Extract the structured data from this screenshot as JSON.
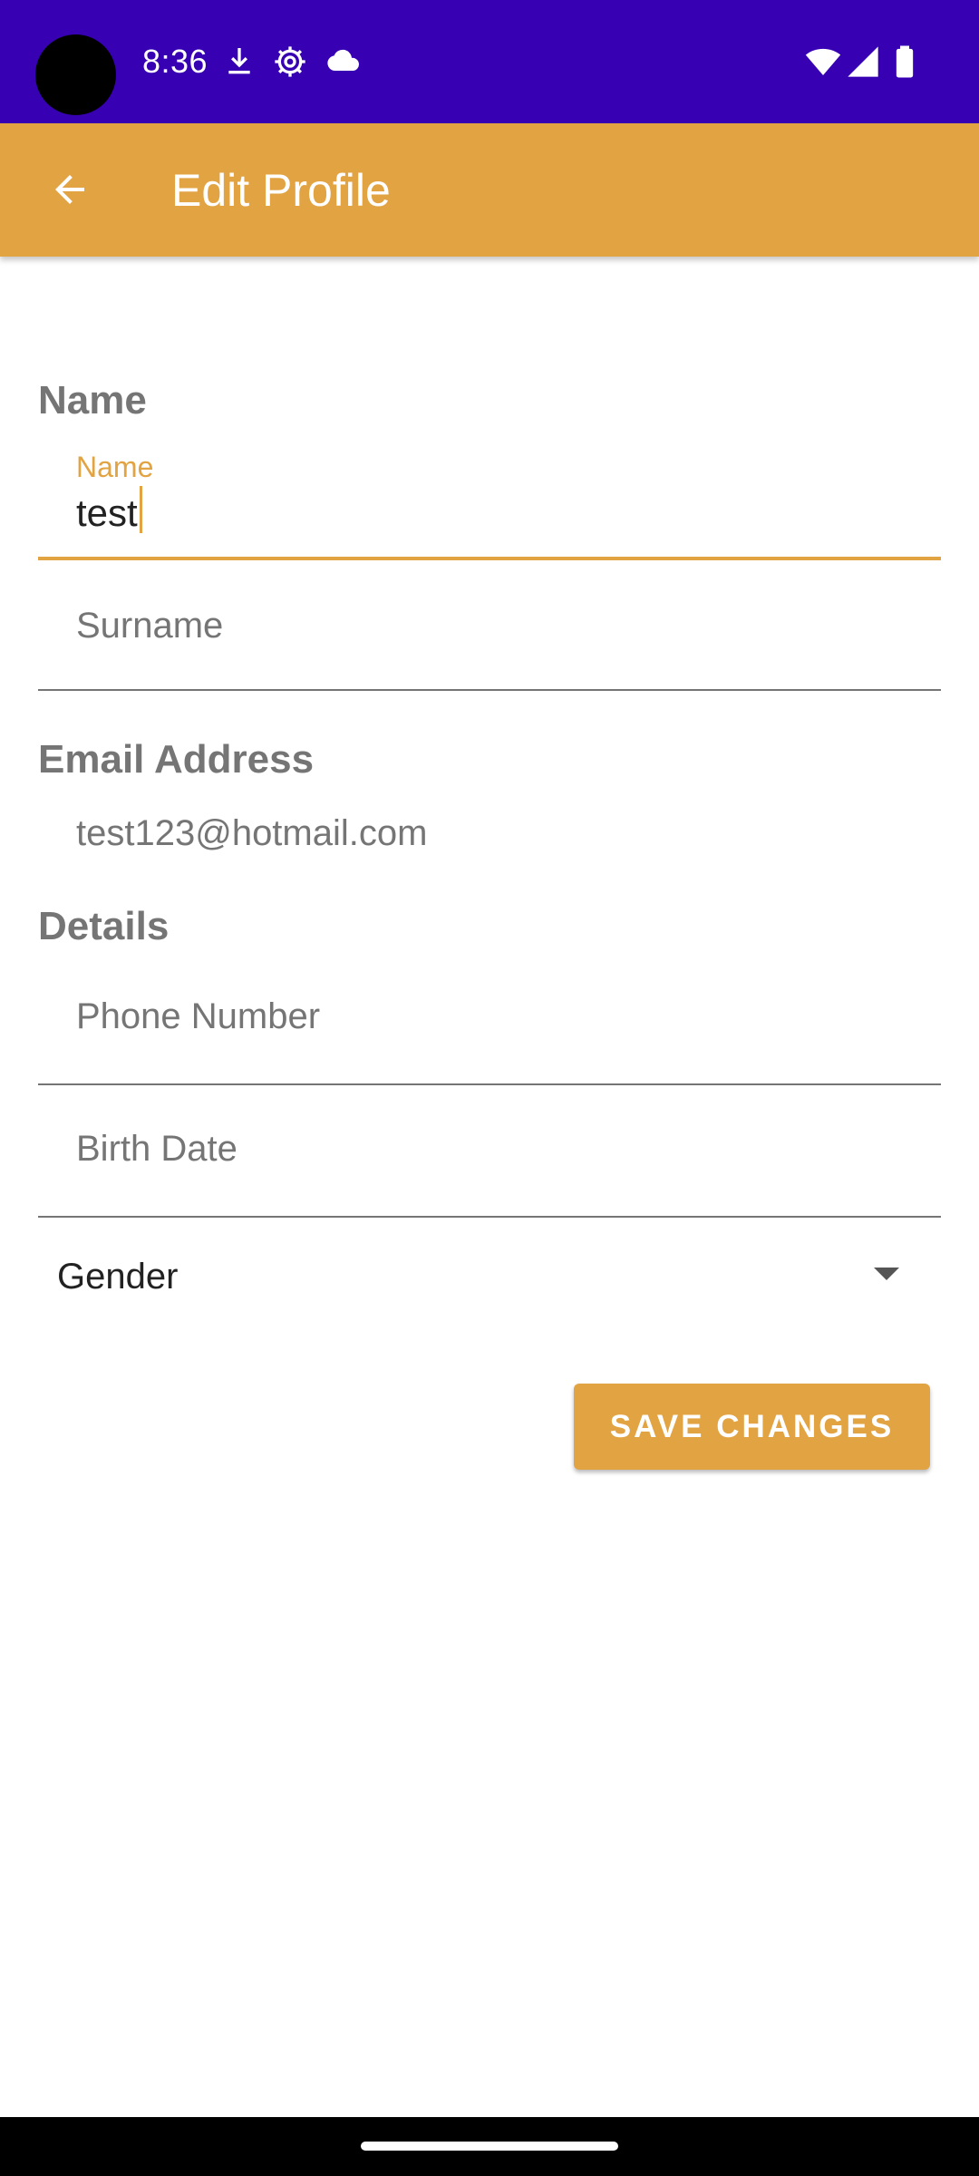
{
  "status_bar": {
    "time": "8:36",
    "color": "#3700b3",
    "icons": [
      "download-icon",
      "settings-gear-icon",
      "cloud-icon",
      "wifi-icon",
      "cellular-signal-icon",
      "battery-icon"
    ]
  },
  "app_bar": {
    "title": "Edit Profile",
    "back_icon": "arrow-back-icon",
    "color": "#e2a342"
  },
  "sections": {
    "name_header": "Name",
    "email_header": "Email Address",
    "details_header": "Details"
  },
  "form": {
    "name": {
      "label": "Name",
      "value": "test"
    },
    "surname": {
      "placeholder": "Surname",
      "value": ""
    },
    "email": {
      "value": "test123@hotmail.com"
    },
    "phone": {
      "placeholder": "Phone Number",
      "value": ""
    },
    "birth_date": {
      "placeholder": "Birth Date",
      "value": ""
    },
    "gender": {
      "label": "Gender",
      "icon": "dropdown-caret-icon"
    }
  },
  "actions": {
    "save_label": "SAVE CHANGES",
    "accent": "#e2a342"
  }
}
